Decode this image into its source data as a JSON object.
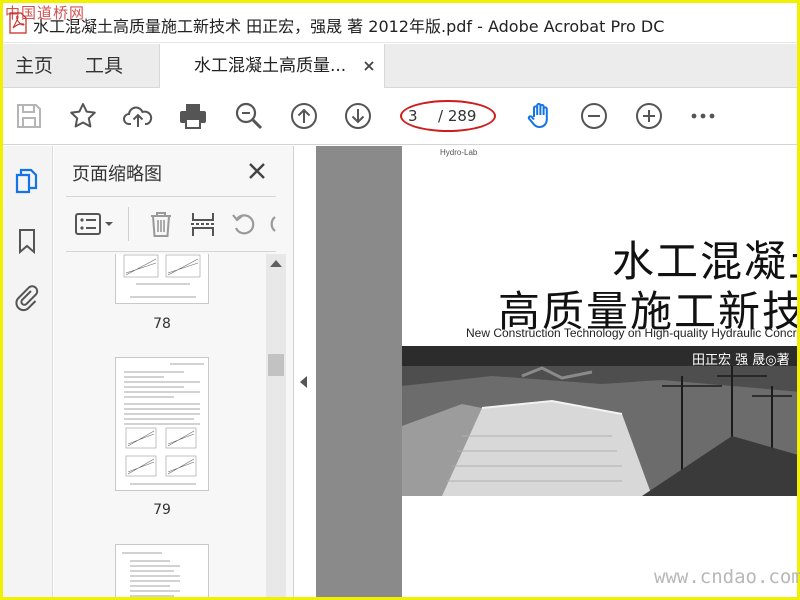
{
  "window": {
    "title": "水工混凝土高质量施工新技术 田正宏，强晟 著 2012年版.pdf - Adobe Acrobat Pro DC",
    "watermark_top": "中国道桥网"
  },
  "tabs": {
    "home": "主页",
    "tools": "工具",
    "document": "水工混凝土高质量...",
    "close_icon": "close-icon"
  },
  "toolbar": {
    "page_current": "3",
    "page_total": "/ 289",
    "highlight_color": "#d11a1a",
    "accent_color": "#1473e6"
  },
  "panel": {
    "title": "页面缩略图",
    "thumbnails": [
      {
        "label": "78"
      },
      {
        "label": "79"
      },
      {
        "label": ""
      }
    ]
  },
  "document": {
    "brand": "Hydro-Lab",
    "title_line1": "水工混凝土",
    "title_line2": "高质量施工新技术",
    "subtitle": "New Construction Technology on High-quality Hydraulic Concrete",
    "authors": "田正宏    强 晟◎著"
  },
  "watermark_bottom": "www.cndao.com"
}
